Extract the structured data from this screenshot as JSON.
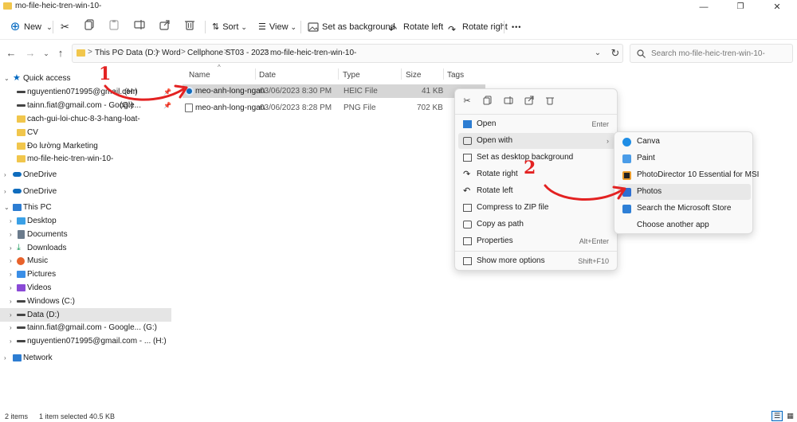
{
  "window": {
    "title": "mo-file-heic-tren-win-10-",
    "controls": {
      "minimize": "—",
      "maximize": "❐",
      "close": "✕"
    }
  },
  "commandbar": {
    "new_label": "New",
    "new_chevron": "⌄",
    "sort_label": "Sort",
    "view_label": "View",
    "set_background_label": "Set as background",
    "rotate_left_label": "Rotate left",
    "rotate_right_label": "Rotate right",
    "more_label": "•••"
  },
  "address": {
    "crumbs": [
      "This PC",
      "Data (D:)",
      "Word",
      "Cellphone S",
      "T03 - 2023",
      "mo-file-heic-tren-win-10-"
    ],
    "separator": ">",
    "search_placeholder": "Search mo-file-heic-tren-win-10-"
  },
  "navpane": {
    "quick_access": "Quick access",
    "pinned": [
      "nguyentien071995@gmail.com",
      "tainn.fiat@gmail.com - Google...",
      "cach-gui-loi-chuc-8-3-hang-loat-",
      "CV",
      "Đo lường Marketing",
      "mo-file-heic-tren-win-10-"
    ],
    "pinned_drive_hints": [
      "(H:)",
      "(G:)"
    ],
    "onedrive1": "OneDrive",
    "onedrive2": "OneDrive",
    "this_pc": "This PC",
    "pc_items": [
      "Desktop",
      "Documents",
      "Downloads",
      "Music",
      "Pictures",
      "Videos",
      "Windows (C:)",
      "Data (D:)",
      "tainn.fiat@gmail.com - Google... (G:)",
      "nguyentien071995@gmail.com - ... (H:)"
    ],
    "network": "Network"
  },
  "filelist": {
    "columns": [
      "Name",
      "Date",
      "Type",
      "Size",
      "Tags"
    ],
    "rows": [
      {
        "name": "meo-anh-long-ngan",
        "date": "03/06/2023 8:30 PM",
        "type": "HEIC File",
        "size": "41 KB"
      },
      {
        "name": "meo-anh-long-ngan",
        "date": "03/06/2023 8:28 PM",
        "type": "PNG File",
        "size": "702 KB"
      }
    ]
  },
  "context_menu": {
    "items": [
      {
        "label": "Open",
        "shortcut": "Enter"
      },
      {
        "label": "Open with",
        "shortcut": "›"
      },
      {
        "label": "Set as desktop background",
        "shortcut": ""
      },
      {
        "label": "Rotate right",
        "shortcut": ""
      },
      {
        "label": "Rotate left",
        "shortcut": ""
      },
      {
        "label": "Compress to ZIP file",
        "shortcut": ""
      },
      {
        "label": "Copy as path",
        "shortcut": ""
      },
      {
        "label": "Properties",
        "shortcut": "Alt+Enter"
      },
      {
        "label": "Show more options",
        "shortcut": "Shift+F10"
      }
    ]
  },
  "open_with_menu": {
    "items": [
      "Canva",
      "Paint",
      "PhotoDirector 10 Essential for MSI",
      "Photos",
      "Search the Microsoft Store",
      "Choose another app"
    ]
  },
  "annotations": {
    "step1": "1",
    "step2": "2",
    "color": "#e32222"
  },
  "status": {
    "items_count": "2 items",
    "selection": "1 item selected  40.5 KB"
  },
  "colors": {
    "accent": "#0067c0",
    "folder": "#f1c64c",
    "selected_row": "#d6d6d6"
  }
}
